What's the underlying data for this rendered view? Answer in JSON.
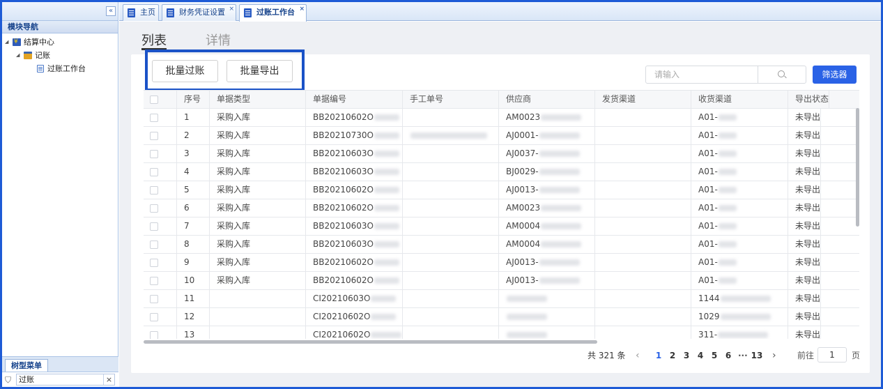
{
  "left_nav": {
    "collapse_label": "«",
    "header": "模块导航",
    "tree": [
      {
        "label": "结算中心",
        "icon": "settlement-icon",
        "level": 0
      },
      {
        "label": "记账",
        "icon": "folder-mail-icon",
        "level": 1
      },
      {
        "label": "过账工作台",
        "icon": "document-icon",
        "level": 2
      }
    ],
    "tree_tab": "树型菜单",
    "filter_value": "过账",
    "filter_clear": "×"
  },
  "tabs": [
    {
      "label": "主页",
      "closable": false,
      "active": false
    },
    {
      "label": "财务凭证设置",
      "closable": true,
      "active": false
    },
    {
      "label": "过账工作台",
      "closable": true,
      "active": true
    }
  ],
  "tab_close_glyph": "×",
  "view_tabs": {
    "list": "列表",
    "detail": "详情"
  },
  "toolbar": {
    "batch_post": "批量过账",
    "batch_export": "批量导出"
  },
  "search": {
    "placeholder": "请输入"
  },
  "filter_button": "筛选器",
  "columns": [
    "序号",
    "单据类型",
    "单据编号",
    "手工单号",
    "供应商",
    "发货渠道",
    "收货渠道",
    "导出状态"
  ],
  "rows": [
    {
      "no": "1",
      "type": "采购入库",
      "doc": "BB20210602O",
      "manual": "",
      "supplier": "AM0023",
      "ship": "",
      "recv": "A01-",
      "status": "未导出"
    },
    {
      "no": "2",
      "type": "采购入库",
      "doc": "BB20210730O",
      "manual": "",
      "supplier": "AJ0001-",
      "ship": "",
      "recv": "A01-",
      "status": "未导出"
    },
    {
      "no": "3",
      "type": "采购入库",
      "doc": "BB20210603O",
      "manual": "",
      "supplier": "AJ0037-",
      "ship": "",
      "recv": "A01-",
      "status": "未导出"
    },
    {
      "no": "4",
      "type": "采购入库",
      "doc": "BB20210603O",
      "manual": "",
      "supplier": "BJ0029-",
      "ship": "",
      "recv": "A01-",
      "status": "未导出"
    },
    {
      "no": "5",
      "type": "采购入库",
      "doc": "BB20210602O",
      "manual": "",
      "supplier": "AJ0013-",
      "ship": "",
      "recv": "A01-",
      "status": "未导出"
    },
    {
      "no": "6",
      "type": "采购入库",
      "doc": "BB20210602O",
      "manual": "",
      "supplier": "AM0023",
      "ship": "",
      "recv": "A01-",
      "status": "未导出"
    },
    {
      "no": "7",
      "type": "采购入库",
      "doc": "BB20210603O",
      "manual": "",
      "supplier": "AM0004",
      "ship": "",
      "recv": "A01-",
      "status": "未导出"
    },
    {
      "no": "8",
      "type": "采购入库",
      "doc": "BB20210603O",
      "manual": "",
      "supplier": "AM0004",
      "ship": "",
      "recv": "A01-",
      "status": "未导出"
    },
    {
      "no": "9",
      "type": "采购入库",
      "doc": "BB20210602O",
      "manual": "",
      "supplier": "AJ0013-",
      "ship": "",
      "recv": "A01-",
      "status": "未导出"
    },
    {
      "no": "10",
      "type": "采购入库",
      "doc": "BB20210602O",
      "manual": "",
      "supplier": "AJ0013-",
      "ship": "",
      "recv": "A01-",
      "status": "未导出"
    },
    {
      "no": "11",
      "type": "",
      "doc": "CI20210603O",
      "manual": "",
      "supplier": "",
      "ship": "",
      "recv": "1144",
      "status": "未导出"
    },
    {
      "no": "12",
      "type": "",
      "doc": "CI20210602O",
      "manual": "",
      "supplier": "",
      "ship": "",
      "recv": "1029",
      "status": "未导出"
    },
    {
      "no": "13",
      "type": "",
      "doc": "CI20210602O",
      "manual": "",
      "supplier": "",
      "ship": "",
      "recv": "311-",
      "status": "未导出"
    }
  ],
  "pagination": {
    "total": "共 321 条",
    "prev": "‹",
    "pages": [
      "1",
      "2",
      "3",
      "4",
      "5",
      "6"
    ],
    "ellipsis": "···",
    "last_page": "13",
    "next": "›",
    "goto_label": "前往",
    "goto_value": "1",
    "page_suffix": "页",
    "current_page": "1"
  }
}
